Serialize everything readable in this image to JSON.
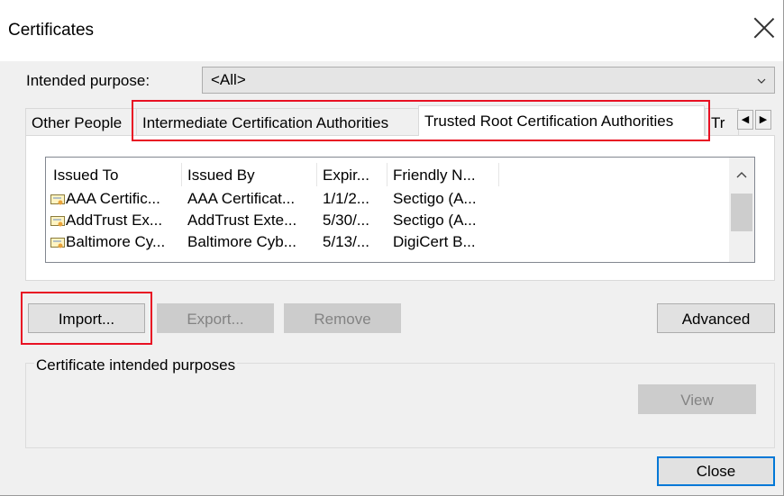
{
  "dialog": {
    "title": "Certificates"
  },
  "purpose": {
    "label": "Intended purpose:",
    "value": "<All>"
  },
  "tabs": [
    {
      "label": "Other People"
    },
    {
      "label": "Intermediate Certification Authorities"
    },
    {
      "label": "Trusted Root Certification Authorities"
    },
    {
      "label": "Tr"
    }
  ],
  "list": {
    "columns": [
      "Issued To",
      "Issued By",
      "Expir...",
      "Friendly N..."
    ],
    "rows": [
      [
        "AAA Certific...",
        "AAA Certificat...",
        "1/1/2...",
        "Sectigo (A..."
      ],
      [
        "AddTrust Ex...",
        "AddTrust Exte...",
        "5/30/...",
        "Sectigo (A..."
      ],
      [
        "Baltimore Cy...",
        "Baltimore Cyb...",
        "5/13/...",
        "DigiCert B..."
      ]
    ]
  },
  "buttons": {
    "import": "Import...",
    "export": "Export...",
    "remove": "Remove",
    "advanced": "Advanced",
    "view": "View",
    "close": "Close"
  },
  "group": {
    "title": "Certificate intended purposes"
  },
  "colors": {
    "highlight": "#e81123",
    "accent": "#0078d7"
  },
  "icons": [
    "close-icon",
    "chevron-down-icon",
    "certificate-icon",
    "scroll-up-icon",
    "scroll-left-icon",
    "scroll-right-icon"
  ]
}
